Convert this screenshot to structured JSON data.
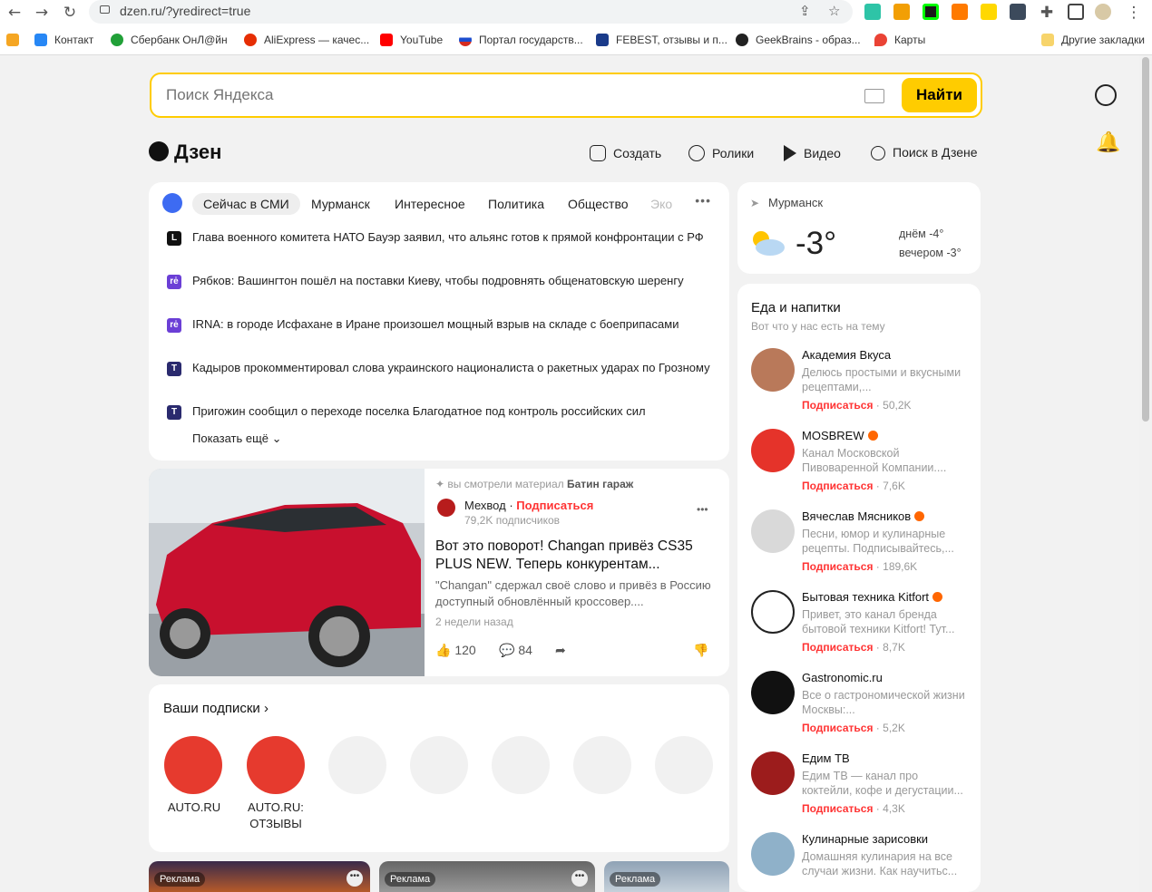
{
  "browser": {
    "url": "dzen.ru/?yredirect=true",
    "bookmarks": [
      {
        "label": "",
        "color": "#f5a623"
      },
      {
        "label": "Контакт",
        "color": "#2787f5"
      },
      {
        "label": "Сбербанк ОнЛ@йн",
        "color": "#21a038"
      },
      {
        "label": "AliExpress — качес...",
        "color": "#e62e04"
      },
      {
        "label": "YouTube",
        "color": "#ff0000"
      },
      {
        "label": "Портал государств...",
        "color": "#1d4ecf"
      },
      {
        "label": "FEBEST, отзывы и п...",
        "color": "#1a3b8a"
      },
      {
        "label": "GeekBrains - образ...",
        "color": "#222222"
      },
      {
        "label": "Карты",
        "color": "#ea4335"
      },
      {
        "label": "Другие закладки",
        "color": "#f7d46b"
      }
    ]
  },
  "search": {
    "placeholder": "Поиск Яндекса",
    "button": "Найти"
  },
  "header": {
    "logo": "Дзен",
    "nav": [
      "Создать",
      "Ролики",
      "Видео",
      "Поиск в Дзене"
    ]
  },
  "news": {
    "tabs": [
      "Сейчас в СМИ",
      "Мурманск",
      "Интересное",
      "Политика",
      "Общество",
      "Эко"
    ],
    "items": [
      {
        "src": "L",
        "srcColor": "#111111",
        "text": "Глава военного комитета НАТО Бауэр заявил, что альянс готов к прямой конфронтации с РФ"
      },
      {
        "src": "rė",
        "srcColor": "#6b3fd6",
        "text": "Рябков: Вашингтон пошёл на поставки Киеву, чтобы подровнять общенатовскую шеренгу"
      },
      {
        "src": "rė",
        "srcColor": "#6b3fd6",
        "text": "IRNA: в городе Исфахане в Иране произошел мощный взрыв на складе с боеприпасами"
      },
      {
        "src": "T",
        "srcColor": "#2a2a6e",
        "text": "Кадыров прокомментировал слова украинского националиста о ракетных ударах по Грозному"
      },
      {
        "src": "T",
        "srcColor": "#2a2a6e",
        "text": "Пригожин сообщил о переходе поселка Благодатное под контроль российских сил"
      }
    ],
    "more": "Показать ещё"
  },
  "article": {
    "seen_prefix": "вы смотрели материал",
    "seen_source": "Батин гараж",
    "channel": "Мехвод",
    "subscribe": "Подписаться",
    "subscribers": "79,2K подписчиков",
    "title": "Вот это поворот! Changan привёз CS35 PLUS NEW. Теперь конкурентам...",
    "desc": "\"Changan\" сдержал своё слово и привёз в Россию доступный обновлённый кроссовер....",
    "date": "2 недели назад",
    "likes": "120",
    "comments": "84"
  },
  "subscriptions": {
    "title": "Ваши подписки",
    "items": [
      {
        "label": "AUTO.RU",
        "color": "#e63a2e"
      },
      {
        "label": "AUTO.RU: ОТЗЫВЫ",
        "color": "#e63a2e"
      }
    ]
  },
  "ads": {
    "tag": "Реклама"
  },
  "weather": {
    "city": "Мурманск",
    "temp": "-3°",
    "day": "днём -4°",
    "evening": "вечером -3°"
  },
  "food": {
    "title": "Еда и напитки",
    "subtitle": "Вот что у нас есть на тему",
    "subscribe": "Подписаться",
    "channels": [
      {
        "name": "Академия Вкуса",
        "verified": false,
        "desc": "Делюсь простыми и вкусными рецептами,...",
        "count": "50,2K",
        "color": "#b9795a"
      },
      {
        "name": "MOSBREW",
        "verified": true,
        "desc": "Канал Московской Пивоваренной Компании....",
        "count": "7,6K",
        "color": "#e5332a"
      },
      {
        "name": "Вячеслав Мясников",
        "verified": true,
        "desc": "Песни, юмор и кулинарные рецепты. Подписывайтесь,...",
        "count": "189,6K",
        "color": "#d9d9d9"
      },
      {
        "name": "Бытовая техника Kitfort",
        "verified": true,
        "desc": "Привет, это канал бренда бытовой техники Kitfort! Тут...",
        "count": "8,7K",
        "color": "#ffffff"
      },
      {
        "name": "Gastronomic.ru",
        "verified": false,
        "desc": "Все о гастрономической жизни Москвы:...",
        "count": "5,2K",
        "color": "#111111"
      },
      {
        "name": "Едим ТВ",
        "verified": false,
        "desc": "Едим ТВ — канал про коктейли, кофе и дегустации...",
        "count": "4,3K",
        "color": "#9c1c1c"
      },
      {
        "name": "Кулинарные зарисовки",
        "verified": false,
        "desc": "Домашняя кулинария на все случаи жизни. Как научитьс...",
        "count": "",
        "color": "#8fb1c9"
      }
    ]
  }
}
